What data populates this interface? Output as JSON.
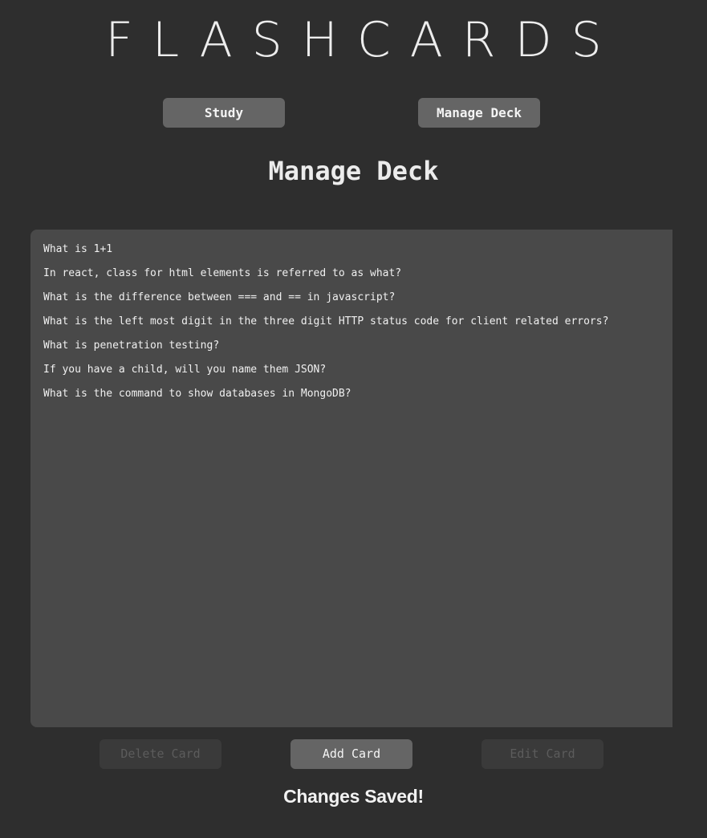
{
  "app": {
    "title": "FLASHCARDS"
  },
  "nav": {
    "study_label": "Study",
    "manage_label": "Manage Deck"
  },
  "page": {
    "title": "Manage Deck"
  },
  "cards": [
    "What is 1+1",
    "In react, class for html elements is referred to as what?",
    "What is the difference between === and == in javascript?",
    "What is the left most digit in the three digit HTTP status code for client related errors?",
    "What is penetration testing?",
    "If you have a child, will you name them JSON?",
    "What is the command to show databases in MongoDB?"
  ],
  "actions": {
    "delete_label": "Delete Card",
    "add_label": "Add Card",
    "edit_label": "Edit Card"
  },
  "status": {
    "message": "Changes Saved!"
  },
  "colors": {
    "background": "#2e2e2e",
    "panel": "#494949",
    "button": "#656565",
    "button_disabled": "#3a3a3a",
    "text": "#ececec",
    "text_disabled": "#5c5c5c"
  }
}
